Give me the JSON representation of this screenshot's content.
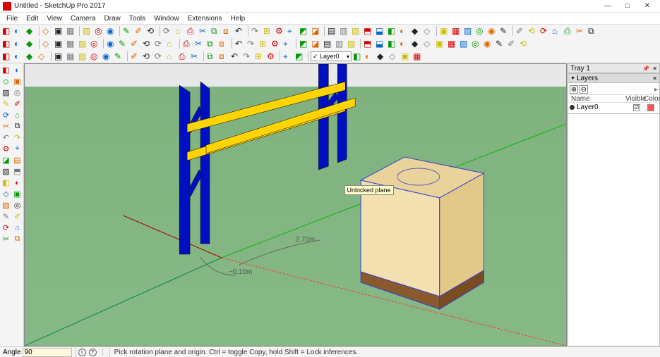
{
  "window": {
    "title": "Untitled - SketchUp Pro 2017",
    "buttons": {
      "min": "—",
      "max": "□",
      "close": "✕"
    }
  },
  "menu": [
    "File",
    "Edit",
    "View",
    "Camera",
    "Draw",
    "Tools",
    "Window",
    "Extensions",
    "Help"
  ],
  "layer_combo": {
    "value": "Layer0"
  },
  "tray": {
    "title": "Tray 1",
    "panel": "Layers",
    "addLabel": "⊕",
    "delLabel": "⊖",
    "cols": {
      "name": "Name",
      "visible": "Visible",
      "color": "Color"
    },
    "row": {
      "name": "Layer0",
      "visible": "☑"
    }
  },
  "viewport": {
    "dim1": "~0.10m",
    "dim2": "2.70m",
    "tooltip": "Unlocked plane"
  },
  "status": {
    "angle_label": "Angle",
    "angle_value": "90",
    "hint": "Pick rotation plane and origin. Ctrl = toggle Copy, hold Shift = Lock inferences.",
    "sepChar": "⋮"
  },
  "icons": {
    "tb1": [
      "plus",
      "arrow",
      "folder",
      "save",
      "cut",
      "copy",
      "paste",
      "delete",
      "undo",
      "redo",
      "print",
      "model",
      "cfg1",
      "cfg2",
      "cfg3",
      "cfg4",
      "cfg5",
      "cfg6",
      "cfg7",
      "house1",
      "house2",
      "house3",
      "house4",
      "house5",
      "list",
      "hatch1",
      "hatch2",
      "hatch3",
      "hatch4",
      "hatch5",
      "hatch6",
      "hatch7",
      "hatch8",
      "hatch9",
      "pat1",
      "pat2",
      "pat3",
      "pat4",
      "pat5",
      "pat6",
      "curve",
      "pgn1",
      "pgn2",
      "pgn3",
      "pgn4",
      "pgn5",
      "pgn6"
    ],
    "tb2": [
      "select",
      "eraser",
      "paint",
      "rect",
      "circle",
      "arc",
      "line",
      "free",
      "push",
      "move",
      "rotate",
      "scale",
      "offset",
      "tape",
      "text",
      "dim",
      "prot",
      "axes",
      "walk",
      "orbit",
      "pan",
      "zoom",
      "zext",
      "prev",
      "style1",
      "style2",
      "shadow",
      "fog",
      "section",
      "img",
      "anim",
      "view1",
      "view2",
      "view3",
      "view4",
      "view5",
      "view6",
      "view7",
      "view8",
      "view9",
      "view10",
      "view11"
    ],
    "tb3": [
      "sel2",
      "grp",
      "ungrp",
      "arc2",
      "c2",
      "poly2",
      "pie",
      "rect2",
      "rrect",
      "3pt",
      "line2",
      "l3",
      "sb1",
      "sb2",
      "sb3",
      "sb4",
      "sb5",
      "sb6",
      "iso1",
      "iso2",
      "iso3",
      "iso4",
      "iso5",
      "iso6"
    ],
    "left": [
      [
        "sel",
        "hand"
      ],
      [
        "pencil",
        "erase"
      ],
      [
        "swirl1",
        "swirl2"
      ],
      [
        "circ",
        "rect"
      ],
      [
        "cyl",
        "push"
      ],
      [
        "knife",
        "offset2"
      ],
      [
        "rfan1",
        "rfan2"
      ],
      [
        "paint2",
        "sample"
      ],
      [
        "tape2",
        "prot2"
      ],
      [
        "text2",
        "dim2"
      ],
      [
        "mag",
        "ax"
      ],
      [
        "walk2",
        "look"
      ],
      [
        "mag2",
        "xr"
      ],
      [
        "sect",
        "sect2"
      ],
      [
        "sun",
        "sun2"
      ],
      [
        "foot",
        "foot2"
      ]
    ]
  }
}
